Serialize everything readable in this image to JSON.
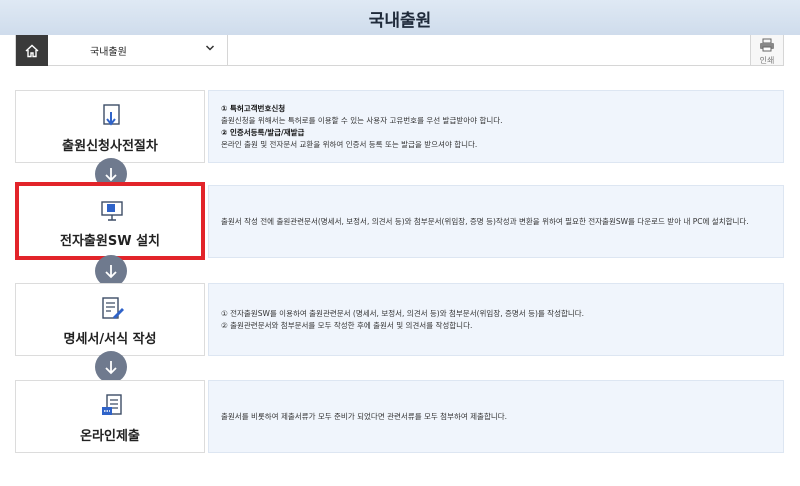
{
  "header": {
    "title": "국내출원"
  },
  "nav": {
    "crumb": "국내출원",
    "print_label": "인쇄"
  },
  "steps": [
    {
      "name": "출원신청사전절차",
      "lines": [
        "① 특허고객번호신청",
        "출원신청을 위해서는 특허로를 이용할 수 있는 사용자 고유번호를 우선 발급받아야 합니다.",
        "② 인증서등록/발급/재발급",
        "온라인 출원 및 전자문서 교환을 위하여 인증서 등록 또는 발급을 받으셔야 합니다."
      ]
    },
    {
      "name": "전자출원SW 설치",
      "lines": [
        "출원서 작성 전에 출원관련문서(명세서, 보정서, 의견서 등)와 첨부문서(위임장, 증명 등)작성과 변환을 위하여 필요한 전자출원SW를 다운로드 받아 내 PC에 설치합니다."
      ]
    },
    {
      "name": "명세서/서식 작성",
      "lines": [
        "① 전자출원SW를 이용하여 출원관련문서 (명세서, 보정서, 의견서 등)와 첨부문서(위임장, 증명서 등)를 작성합니다.",
        "② 출원관련문서와 첨부문서를 모두 작성한 후에 출원서 및 의견서를 작성합니다."
      ]
    },
    {
      "name": "온라인제출",
      "lines": [
        "출원서를 비롯하여 제출서류가 모두 준비가 되었다면 관련서류를 모두 첨부하여 제출합니다."
      ]
    }
  ],
  "colors": {
    "header_bg": "#d6e2ef",
    "highlight": "#e2242a",
    "arrow": "#6f7a8e",
    "desc_bg": "#f0f5fc"
  }
}
